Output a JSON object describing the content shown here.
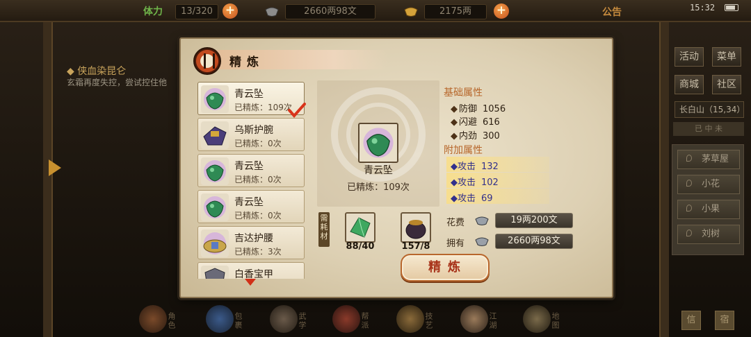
{
  "status_bar": {
    "time": "15:32"
  },
  "top_bar": {
    "stamina_label": "体力",
    "stamina_value": "13/320",
    "silver_value": "2660两98文",
    "gold_value": "2175两",
    "notice_label": "公告"
  },
  "quest": {
    "title": "◆ 侠血染昆仑",
    "description": "玄霜再度失控，尝试控住他"
  },
  "right_menu": {
    "buttons": [
      "活动",
      "菜单",
      "商城",
      "社区"
    ],
    "location": "长白山（15,34）",
    "tab": "已  中  未",
    "npcs": [
      "茅草屋",
      "小花",
      "小果",
      "刘树"
    ],
    "bottom_buttons": [
      "信",
      "宿"
    ]
  },
  "dock": {
    "items": [
      "角色",
      "包裹",
      "武学",
      "帮派",
      "技艺",
      "江湖",
      "地图"
    ]
  },
  "dialog": {
    "title": "精炼",
    "items": [
      {
        "name": "青云坠",
        "refine": "已精炼：109次",
        "icon": "green-jade-pendant-icon"
      },
      {
        "name": "乌斯护腕",
        "refine": "已精炼：0次",
        "icon": "bracer-icon"
      },
      {
        "name": "青云坠",
        "refine": "已精炼：0次",
        "icon": "green-jade-pendant-icon"
      },
      {
        "name": "青云坠",
        "refine": "已精炼：0次",
        "icon": "green-jade-pendant-icon"
      },
      {
        "name": "吉达护腰",
        "refine": "已精炼：3次",
        "icon": "belt-icon"
      },
      {
        "name": "白香宝甲",
        "refine": "",
        "icon": "armor-icon"
      }
    ],
    "preview": {
      "name": "青云坠",
      "refine": "已精炼：109次"
    },
    "base_attr_title": "基础属性",
    "base_attrs": [
      {
        "name": "防御",
        "value": "1056"
      },
      {
        "name": "闪避",
        "value": "616"
      },
      {
        "name": "内劲",
        "value": "300"
      }
    ],
    "extra_attr_title": "附加属性",
    "extra_attrs": [
      {
        "name": "攻击",
        "value": "132"
      },
      {
        "name": "攻击",
        "value": "102"
      },
      {
        "name": "攻击",
        "value": "69"
      }
    ],
    "materials_label": "需耗材",
    "materials": [
      {
        "icon": "green-crystal-icon",
        "count": "88/40"
      },
      {
        "icon": "pot-icon",
        "count": "157/8"
      }
    ],
    "cost_label": "花费",
    "cost_value": "19两200文",
    "own_label": "拥有",
    "own_value": "2660两98文",
    "refine_button": "精炼"
  }
}
